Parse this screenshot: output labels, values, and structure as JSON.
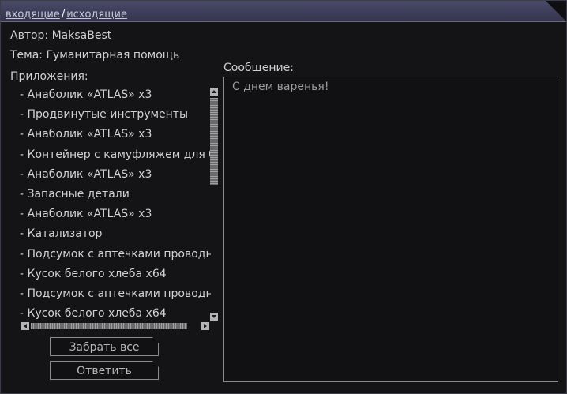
{
  "header": {
    "tab_incoming": "входящие",
    "separator": "/",
    "tab_outgoing": "исходящие"
  },
  "mail": {
    "author": "Автор: MaksaBest",
    "subject": "Тема: Гуманитарная помощь",
    "attachments_label": "Приложения:",
    "attachments": [
      "- Анаболик «ATLAS» x3",
      "- Продвинутые инструменты",
      "- Анаболик «ATLAS» x3",
      "- Контейнер с камуфляжем для б",
      "- Анаболик «ATLAS» x3",
      "- Запасные детали",
      "- Анаболик «ATLAS» x3",
      "- Катализатор",
      "- Подсумок с аптечками проводн",
      "- Кусок белого хлеба x64",
      "- Подсумок с аптечками проводн",
      "- Кусок белого хлеба x64"
    ],
    "message_label": "Сообщение:",
    "message_text": "С днем варенья!"
  },
  "actions": {
    "take_all": "Забрать все",
    "reply": "Ответить"
  },
  "colors": {
    "background": "#141416",
    "title_bar": "#3f3f5a",
    "text": "#d2d2d2",
    "border": "#8a8a8a"
  }
}
